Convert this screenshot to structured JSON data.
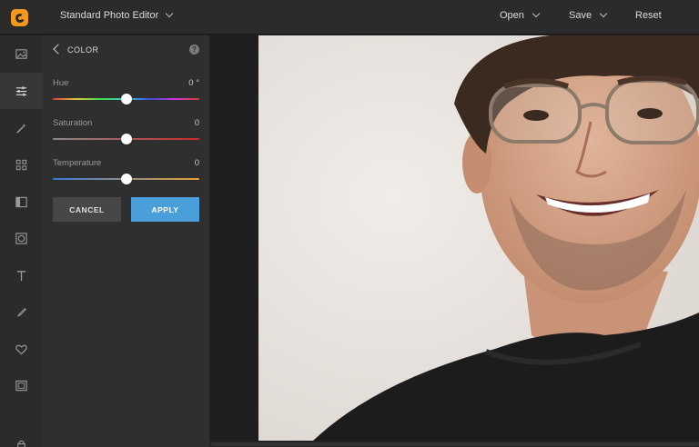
{
  "app": {
    "title": "Standard Photo Editor"
  },
  "top_actions": {
    "open": "Open",
    "save": "Save",
    "reset": "Reset"
  },
  "toolbar": {
    "items": [
      {
        "icon": "image-icon"
      },
      {
        "icon": "sliders-icon",
        "active": true
      },
      {
        "icon": "magic-wand-icon"
      },
      {
        "icon": "grid-icon"
      },
      {
        "icon": "frame-split-icon"
      },
      {
        "icon": "vignette-icon"
      },
      {
        "icon": "text-icon"
      },
      {
        "icon": "brush-icon"
      },
      {
        "icon": "heart-icon"
      },
      {
        "icon": "border-icon"
      },
      {
        "icon": "lock-icon"
      }
    ]
  },
  "panel": {
    "title": "COLOR",
    "sliders": [
      {
        "label": "Hue",
        "value": "0 °",
        "level": 0.5
      },
      {
        "label": "Saturation",
        "value": "0",
        "level": 0.5
      },
      {
        "label": "Temperature",
        "value": "0",
        "level": 0.5
      }
    ],
    "cancel_label": "CANCEL",
    "apply_label": "APPLY"
  },
  "colors": {
    "accent": "#4a9fdb",
    "logo": "#f39a1e",
    "background": "#1f1f1f",
    "panel": "#2f2f2f"
  }
}
